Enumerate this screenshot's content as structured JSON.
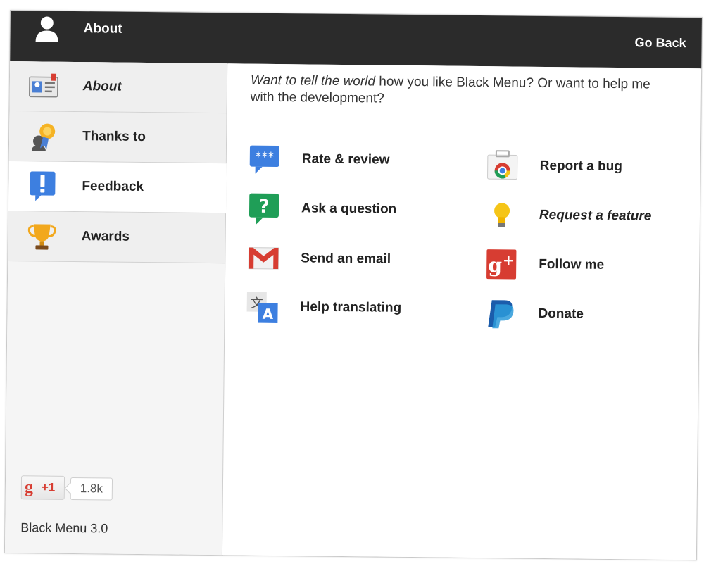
{
  "header": {
    "title": "About",
    "back_label": "Go Back"
  },
  "sidebar": {
    "items": [
      {
        "label": "About",
        "icon": "id-card-icon"
      },
      {
        "label": "Thanks to",
        "icon": "award-ribbon-icon"
      },
      {
        "label": "Feedback",
        "icon": "exclamation-bubble-icon",
        "active": true
      },
      {
        "label": "Awards",
        "icon": "trophy-icon"
      }
    ],
    "plus_one": {
      "label": "+1",
      "count": "1.8k"
    },
    "version": "Black Menu 3.0"
  },
  "main": {
    "intro_line1_italic": "Want to tell the world",
    "intro_rest": " how you like Black Menu? Or want to help me with the development?",
    "actions": [
      {
        "label": "Rate & review",
        "icon": "rate-review-icon"
      },
      {
        "label": "Ask a question",
        "icon": "question-icon"
      },
      {
        "label": "Send an email",
        "icon": "gmail-icon"
      },
      {
        "label": "Help translating",
        "icon": "translate-icon"
      },
      {
        "label": "Report a bug",
        "icon": "chrome-bug-icon"
      },
      {
        "label": "Request a feature",
        "icon": "lightbulb-icon"
      },
      {
        "label": "Follow me",
        "icon": "google-plus-icon"
      },
      {
        "label": "Donate",
        "icon": "paypal-icon"
      }
    ]
  },
  "colors": {
    "topbar": "#2b2b2b",
    "gplus_red": "#d73d32",
    "google_blue": "#3d7fe0",
    "google_green": "#1f9e57",
    "paypal_blue": "#1b5cab"
  }
}
